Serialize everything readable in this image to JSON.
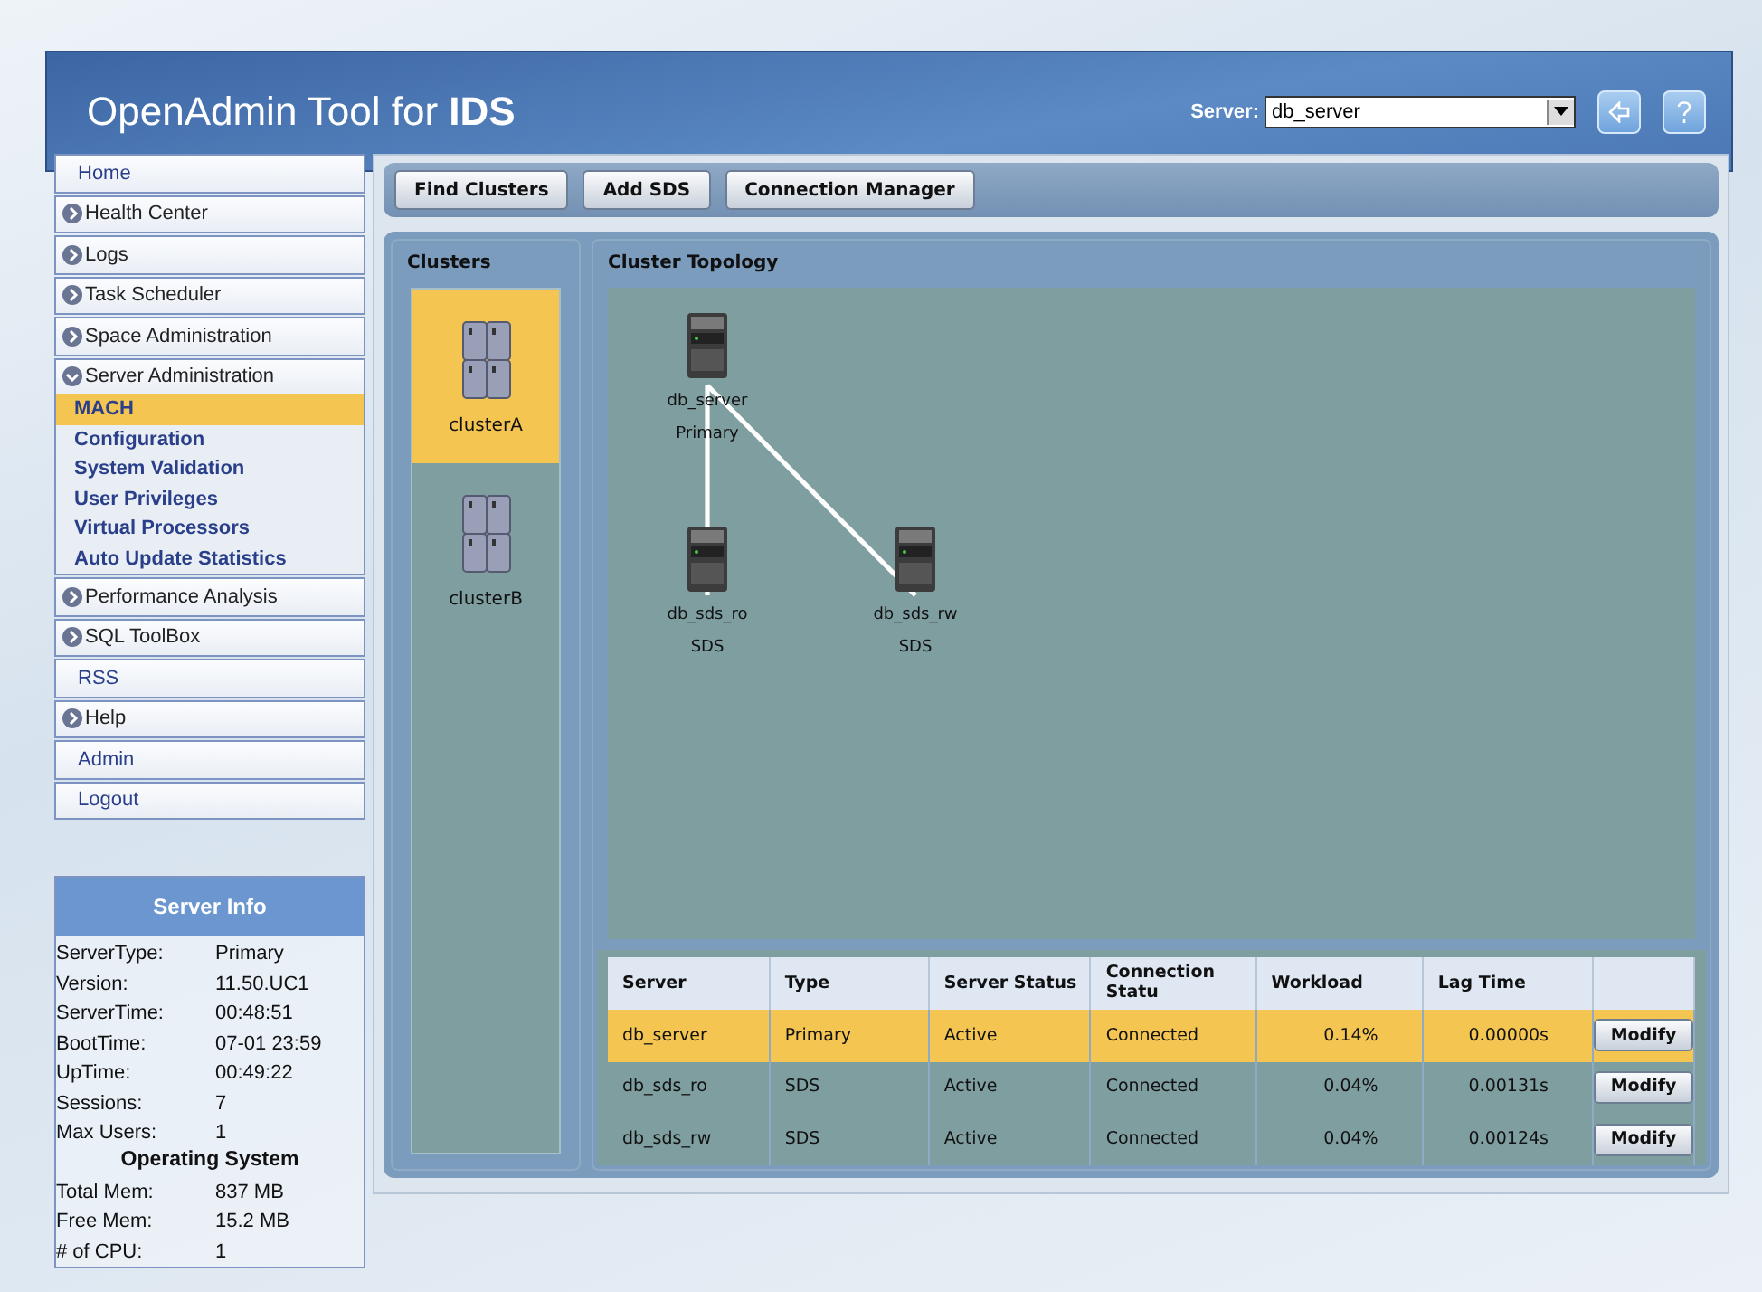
{
  "header": {
    "title_prefix": "OpenAdmin Tool for ",
    "title_bold": "IDS",
    "server_label": "Server:",
    "server_value": "db_server"
  },
  "nav": [
    {
      "label": "Home",
      "kind": "plain",
      "selected": false
    },
    {
      "label": "Health Center",
      "kind": "section",
      "expanded": false,
      "selected": false
    },
    {
      "label": "Logs",
      "kind": "section",
      "expanded": false,
      "selected": false
    },
    {
      "label": "Task Scheduler",
      "kind": "section",
      "expanded": false,
      "selected": false
    },
    {
      "label": "Space Administration",
      "kind": "section",
      "expanded": false,
      "selected": false
    },
    {
      "label": "Server Administration",
      "kind": "section",
      "expanded": true,
      "selected": false,
      "children": [
        {
          "label": "MACH",
          "selected": true
        },
        {
          "label": "Configuration",
          "selected": false
        },
        {
          "label": "System Validation",
          "selected": false
        },
        {
          "label": "User Privileges",
          "selected": false
        },
        {
          "label": "Virtual Processors",
          "selected": false
        },
        {
          "label": "Auto Update Statistics",
          "selected": false
        }
      ]
    },
    {
      "label": "Performance Analysis",
      "kind": "section",
      "expanded": false,
      "selected": false
    },
    {
      "label": "SQL ToolBox",
      "kind": "section",
      "expanded": false,
      "selected": false
    },
    {
      "label": "RSS",
      "kind": "plain",
      "selected": false
    },
    {
      "label": "Help",
      "kind": "section",
      "expanded": false,
      "selected": false
    },
    {
      "label": "Admin",
      "kind": "plain",
      "selected": false
    },
    {
      "label": "Logout",
      "kind": "plain",
      "selected": false
    }
  ],
  "server_info": {
    "title": "Server Info",
    "rows": [
      {
        "label": "ServerType:",
        "value": "Primary"
      },
      {
        "label": "Version:",
        "value": "11.50.UC1"
      },
      {
        "label": "ServerTime:",
        "value": "00:48:51"
      },
      {
        "label": "BootTime:",
        "value": "07-01 23:59"
      },
      {
        "label": "UpTime:",
        "value": "00:49:22"
      },
      {
        "label": "Sessions:",
        "value": "7"
      },
      {
        "label": "Max Users:",
        "value": "1"
      }
    ],
    "os_title": "Operating System",
    "os_rows": [
      {
        "label": "Total Mem:",
        "value": "837 MB"
      },
      {
        "label": "Free Mem:",
        "value": "15.2 MB"
      },
      {
        "label": "# of CPU:",
        "value": "1"
      }
    ]
  },
  "toolbar": [
    "Find Clusters",
    "Add SDS",
    "Connection Manager"
  ],
  "clusters": {
    "title": "Clusters",
    "items": [
      {
        "name": "clusterA",
        "selected": true
      },
      {
        "name": "clusterB",
        "selected": false
      }
    ]
  },
  "topology": {
    "title": "Cluster Topology",
    "nodes": [
      {
        "name": "db_server",
        "role": "Primary"
      },
      {
        "name": "db_sds_ro",
        "role": "SDS",
        "linked": true
      },
      {
        "name": "db_sds_rw",
        "role": "SDS",
        "linked": true
      }
    ]
  },
  "table": {
    "columns": [
      "Server",
      "Type",
      "Server Status",
      "Connection Statu",
      "Workload",
      "Lag Time"
    ],
    "rows": [
      {
        "cells": [
          "db_server",
          "Primary",
          "Active",
          "Connected",
          "0.14%",
          "0.00000s"
        ],
        "action": "Modify",
        "selected": true
      },
      {
        "cells": [
          "db_sds_ro",
          "SDS",
          "Active",
          "Connected",
          "0.04%",
          "0.00131s"
        ],
        "action": "Modify",
        "selected": false
      },
      {
        "cells": [
          "db_sds_rw",
          "SDS",
          "Active",
          "Connected",
          "0.04%",
          "0.00124s"
        ],
        "action": "Modify",
        "selected": false
      }
    ]
  }
}
